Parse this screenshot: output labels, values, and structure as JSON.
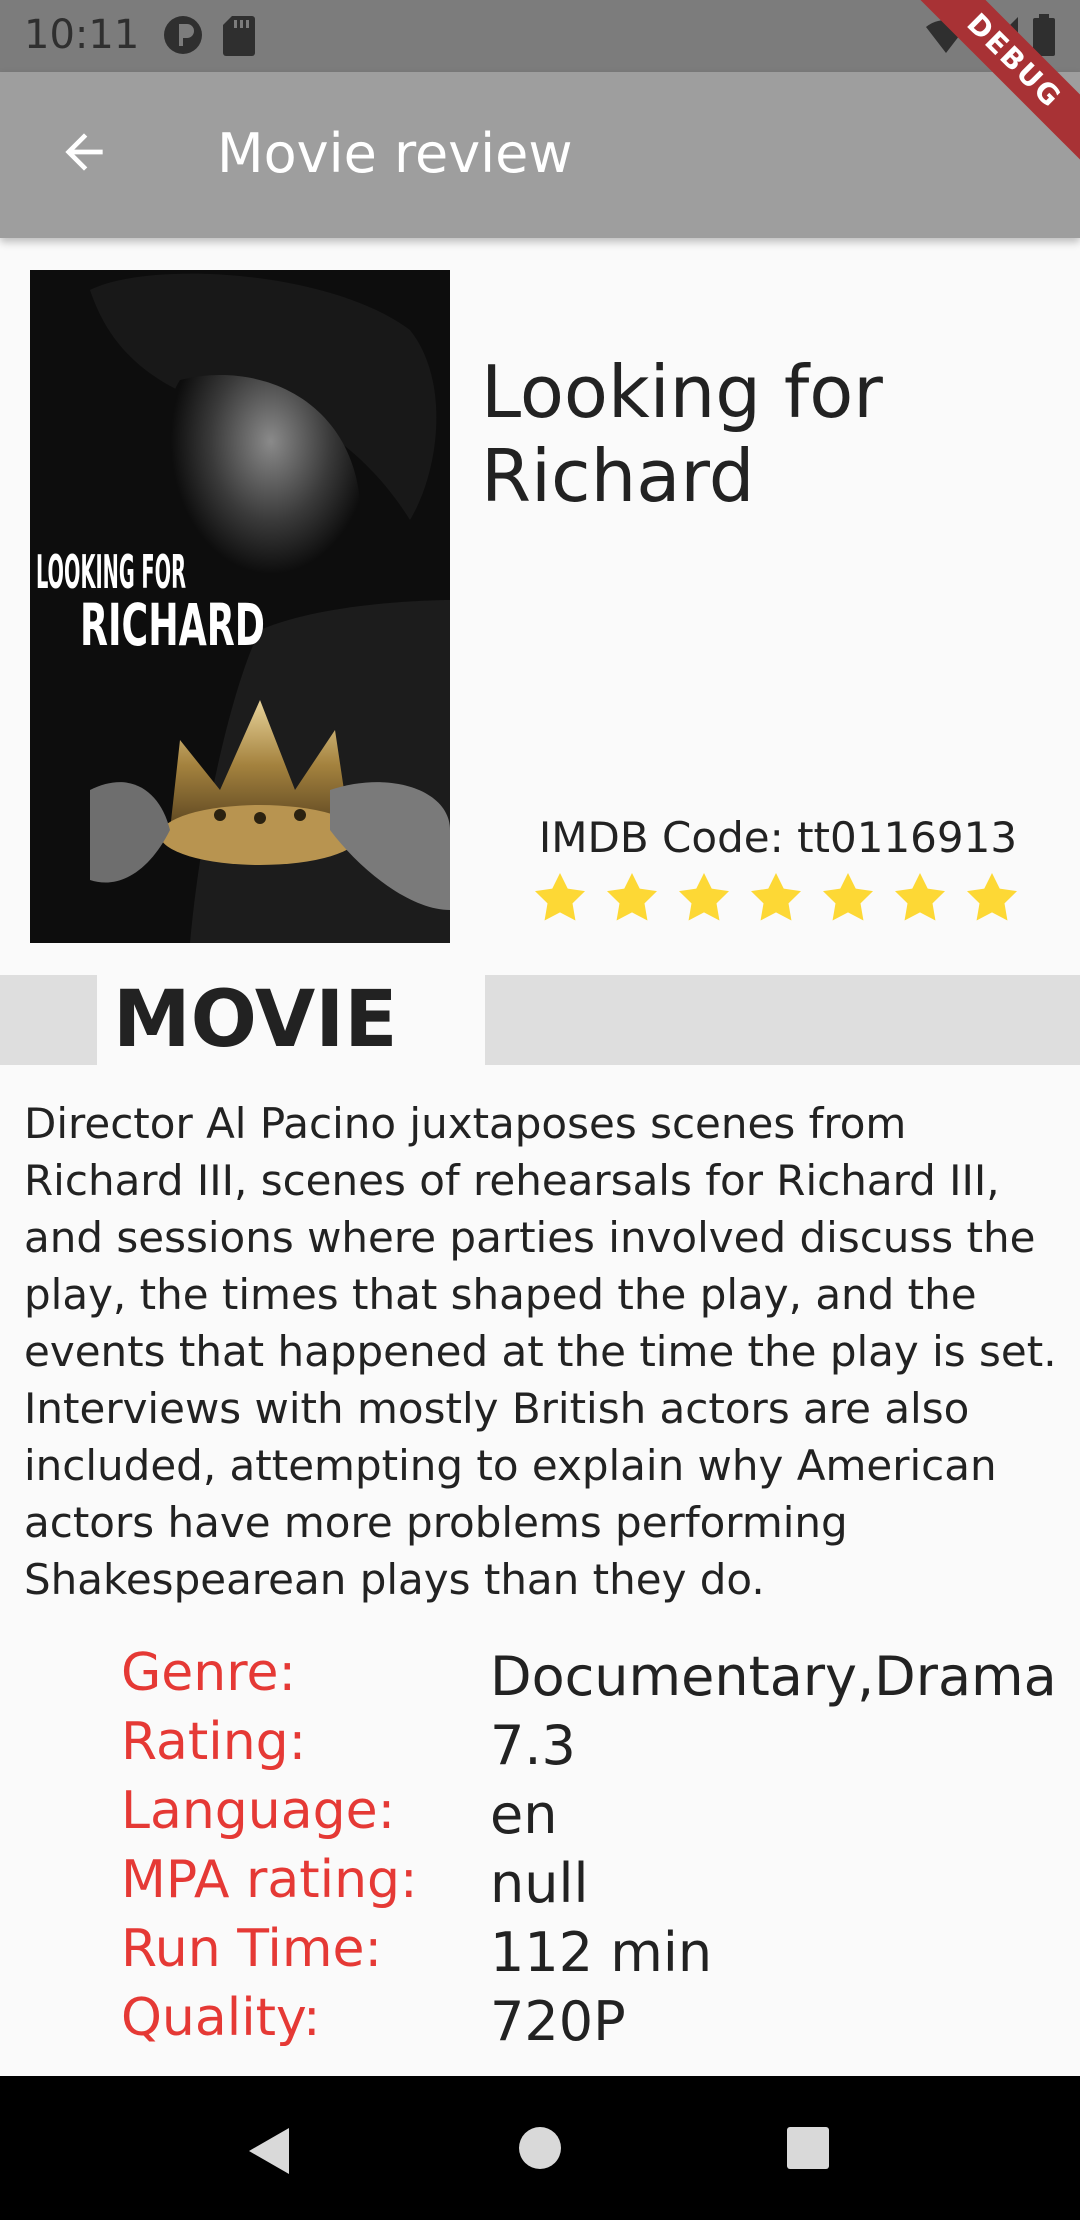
{
  "status_bar": {
    "time": "10:11",
    "icons": [
      "app-icon",
      "sd-card-icon",
      "wifi-icon",
      "signal-icon",
      "battery-icon"
    ]
  },
  "app_bar": {
    "title": "Movie review",
    "back_icon": "arrow-back-icon"
  },
  "debug_banner": "DEBUG",
  "movie": {
    "title": "Looking for Richard",
    "poster_text_line1": "LOOKING FOR",
    "poster_text_line2": "RICHARD",
    "imdb_label": "IMDB Code: tt0116913",
    "star_count": 7,
    "star_color": "#fdd835"
  },
  "section": {
    "label": "MOVIE"
  },
  "description": "Director Al Pacino juxtaposes scenes from Richard III, scenes of rehearsals for Richard III, and sessions where parties involved discuss the play, the times that shaped the play, and the events that happened at the time the play is set. Interviews with mostly British actors are also included, attempting to explain why American actors have more problems performing Shakespearean plays than they do.",
  "details": [
    {
      "label": "Genre:",
      "value": "Documentary,Drama"
    },
    {
      "label": "Rating:",
      "value": "7.3"
    },
    {
      "label": "Language:",
      "value": "en"
    },
    {
      "label": "MPA rating:",
      "value": "null"
    },
    {
      "label": "Run Time:",
      "value": "112 min"
    },
    {
      "label": "Quality:",
      "value": "720P"
    }
  ],
  "colors": {
    "app_bar": "#9e9e9e",
    "status_bar": "#7c7c7c",
    "label_red": "#e53935",
    "section_bar": "#dedede"
  },
  "nav_bar": {
    "icons": [
      "nav-back-icon",
      "nav-home-icon",
      "nav-recents-icon"
    ]
  }
}
